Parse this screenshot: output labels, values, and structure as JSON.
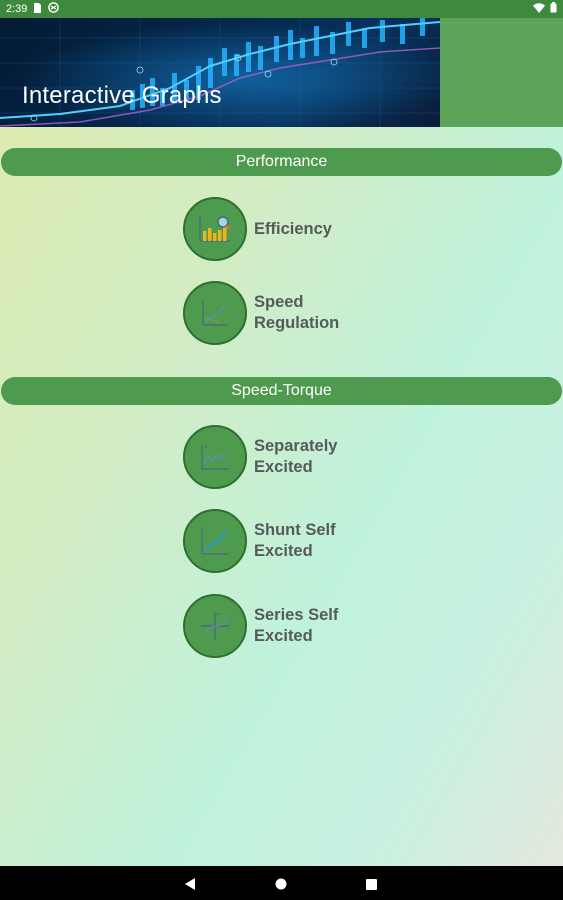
{
  "status_bar": {
    "time": "2:39",
    "icons": [
      "sim-card-icon",
      "accessibility-icon",
      "wifi-icon",
      "battery-icon"
    ]
  },
  "header": {
    "title": "Interactive Graphs",
    "banner": "stock-chart-banner"
  },
  "sections": [
    {
      "label": "Performance",
      "items": [
        {
          "line1": "Efficiency",
          "line2": "",
          "icon": "bar-chart-magnifier-icon"
        },
        {
          "line1": "Speed",
          "line2": "Regulation",
          "icon": "line-graph-icon"
        }
      ]
    },
    {
      "label": "Speed-Torque",
      "items": [
        {
          "line1": "Separately",
          "line2": "Excited",
          "icon": "zigzag-graph-icon"
        },
        {
          "line1": "Shunt Self",
          "line2": "Excited",
          "icon": "rising-graph-icon"
        },
        {
          "line1": "Series Self",
          "line2": "Excited",
          "icon": "quadrant-axes-icon"
        }
      ]
    }
  ],
  "nav_bar": {
    "buttons": [
      "back-icon",
      "home-icon",
      "recents-icon"
    ]
  },
  "colors": {
    "status_bar": "#3d8a3e",
    "header": "#5ca45a",
    "section_bar": "#4e9a4e",
    "item_circle": "#4e9a4e",
    "item_text": "#555a5a"
  }
}
